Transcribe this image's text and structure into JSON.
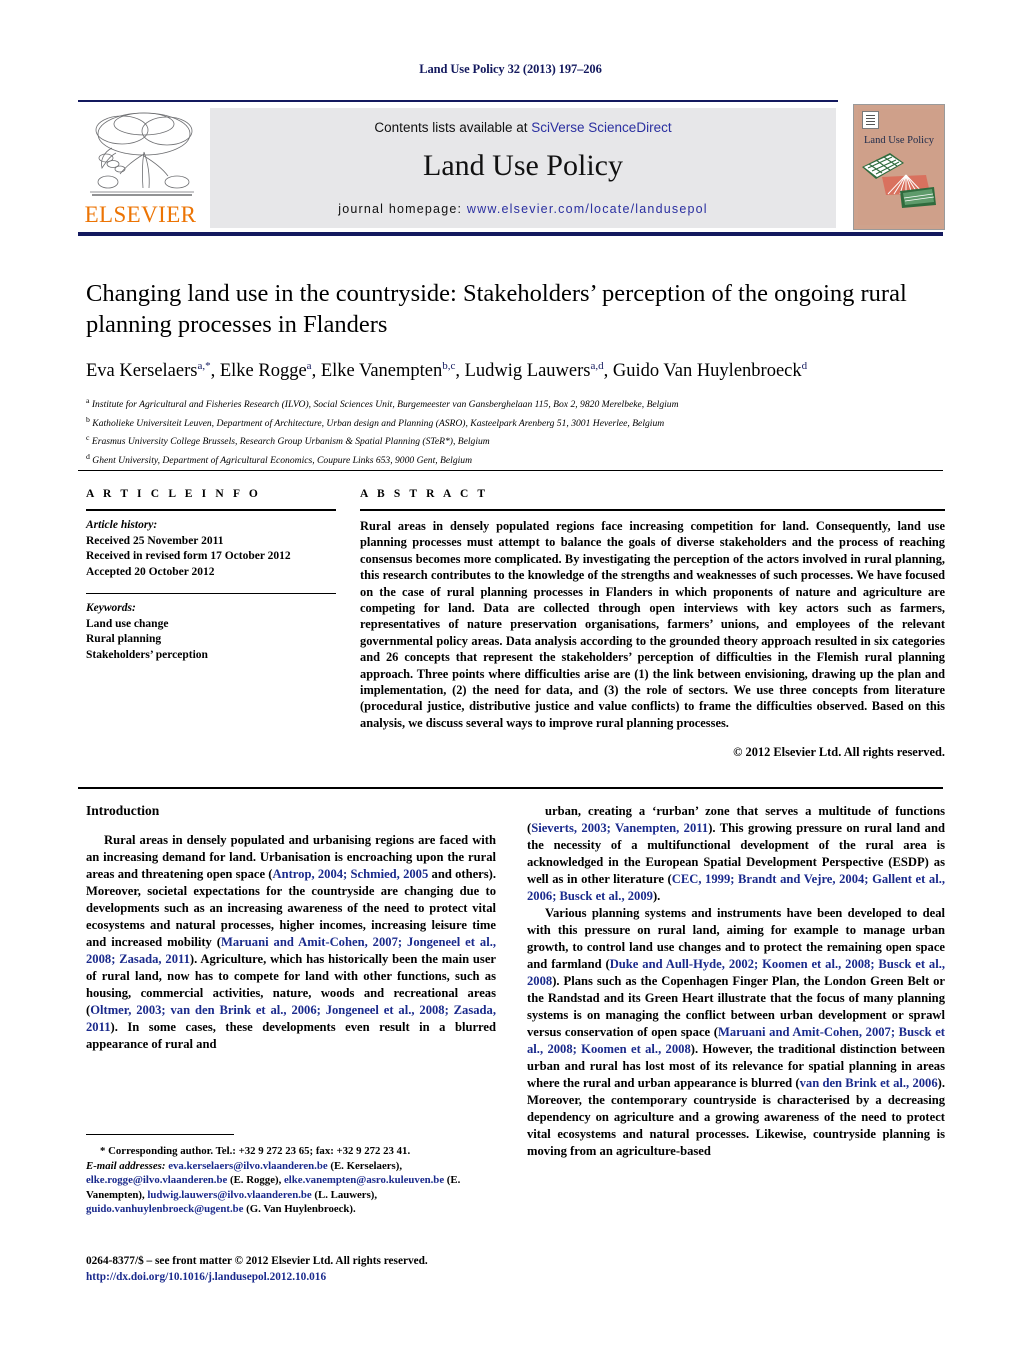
{
  "running_head": "Land Use Policy 32 (2013) 197–206",
  "masthead": {
    "contents_prefix": "Contents lists available at ",
    "contents_link": "SciVerse ScienceDirect",
    "journal_title": "Land Use Policy",
    "homepage_prefix": "journal homepage: ",
    "homepage_url": "www.elsevier.com/locate/landusepol",
    "publisher": "ELSEVIER",
    "cover_title": "Land Use Policy"
  },
  "article": {
    "title": "Changing land use in the countryside: Stakeholders’ perception of the ongoing rural planning processes in Flanders",
    "authors_html": "Eva Kerselaers<sup>a,*</sup>, Elke Rogge<sup>a</sup>, Elke Vanempten<sup>b,c</sup>, Ludwig Lauwers<sup>a,d</sup>, Guido Van Huylenbroeck<sup>d</sup>",
    "affiliations": [
      "Institute for Agricultural and Fisheries Research (ILVO), Social Sciences Unit, Burgemeester van Gansberghelaan 115, Box 2, 9820 Merelbeke, Belgium",
      "Katholieke Universiteit Leuven, Department of Architecture, Urban design and Planning (ASRO), Kasteelpark Arenberg 51, 3001 Heverlee, Belgium",
      "Erasmus University College Brussels, Research Group Urbanism & Spatial Planning (STeR*), Belgium",
      "Ghent University, Department of Agricultural Economics, Coupure Links 653, 9000 Gent, Belgium"
    ],
    "affiliation_markers": [
      "a",
      "b",
      "c",
      "d"
    ]
  },
  "article_info": {
    "heading": "A R T I C L E    I N F O",
    "history_label": "Article history:",
    "history": [
      "Received 25 November 2011",
      "Received in revised form 17 October 2012",
      "Accepted 20 October 2012"
    ],
    "keywords_label": "Keywords:",
    "keywords": [
      "Land use change",
      "Rural planning",
      "Stakeholders’ perception"
    ]
  },
  "abstract": {
    "heading": "A B S T R A C T",
    "text": "Rural areas in densely populated regions face increasing competition for land. Consequently, land use planning processes must attempt to balance the goals of diverse stakeholders and the process of reaching consensus becomes more complicated. By investigating the perception of the actors involved in rural planning, this research contributes to the knowledge of the strengths and weaknesses of such processes. We have focused on the case of rural planning processes in Flanders in which proponents of nature and agriculture are competing for land. Data are collected through open interviews with key actors such as farmers, representatives of nature preservation organisations, farmers’ unions, and employees of the relevant governmental policy areas. Data analysis according to the grounded theory approach resulted in six categories and 26 concepts that represent the stakeholders’ perception of difficulties in the Flemish rural planning approach. Three points where difficulties arise are (1) the link between envisioning, drawing up the plan and implementation, (2) the need for data, and (3) the role of sectors. We use three concepts from literature (procedural justice, distributive justice and value conflicts) to frame the difficulties observed. Based on this analysis, we discuss several ways to improve rural planning processes.",
    "copyright": "© 2012 Elsevier Ltd. All rights reserved."
  },
  "body": {
    "section_heading": "Introduction",
    "left_paragraphs": [
      "Rural areas in densely populated and urbanising regions are faced with an increasing demand for land. Urbanisation is encroaching upon the rural areas and threatening open space (<span class=\"ref\">Antrop, 2004; Schmied, 2005</span> and others). Moreover, societal expectations for the countryside are changing due to developments such as an increasing awareness of the need to protect vital ecosystems and natural processes, higher incomes, increasing leisure time and increased mobility (<span class=\"ref\">Maruani and Amit-Cohen, 2007; Jongeneel et al., 2008; Zasada, 2011</span>). Agriculture, which has historically been the main user of rural land, now has to compete for land with other functions, such as housing, commercial activities, nature, woods and recreational areas (<span class=\"ref\">Oltmer, 2003; van den Brink et al., 2006; Jongeneel et al., 2008; Zasada, 2011</span>). In some cases, these developments even result in a blurred appearance of rural and"
    ],
    "right_paragraphs": [
      "urban, creating a ‘rurban’ zone that serves a multitude of functions (<span class=\"ref\">Sieverts, 2003; Vanempten, 2011</span>). This growing pressure on rural land and the necessity of a multifunctional development of the rural area is acknowledged in the European Spatial Development Perspective (ESDP) as well as in other literature (<span class=\"ref\">CEC, 1999; Brandt and Vejre, 2004; Gallent et al., 2006; Busck et al., 2009</span>).",
      "Various planning systems and instruments have been developed to deal with this pressure on rural land, aiming for example to manage urban growth, to control land use changes and to protect the remaining open space and farmland (<span class=\"ref\">Duke and Aull-Hyde, 2002; Koomen et al., 2008; Busck et al., 2008</span>). Plans such as the Copenhagen Finger Plan, the London Green Belt or the Randstad and its Green Heart illustrate that the focus of many planning systems is on managing the conflict between urban development or sprawl versus conservation of open space (<span class=\"ref\">Maruani and Amit-Cohen, 2007; Busck et al., 2008; Koomen et al., 2008</span>). However, the traditional distinction between urban and rural has lost most of its relevance for spatial planning in areas where the rural and urban appearance is blurred (<span class=\"ref\">van den Brink et al., 2006</span>). Moreover, the contemporary countryside is characterised by a decreasing dependency on agriculture and a growing awareness of the need to protect vital ecosystems and natural processes. Likewise, countryside planning is moving from an agriculture-based"
    ]
  },
  "footnotes": {
    "corresponding": "* Corresponding author. Tel.: +32 9 272 23 65; fax: +32 9 272 23 41.",
    "email_label": "E-mail addresses:",
    "emails_html": "<span class=\"mail\">eva.kerselaers@ilvo.vlaanderen.be</span> (E. Kerselaers), <span class=\"mail\">elke.rogge@ilvo.vlaanderen.be</span> (E. Rogge), <span class=\"mail\">elke.vanempten@asro.kuleuven.be</span> (E. Vanempten), <span class=\"mail\">ludwig.lauwers@ilvo.vlaanderen.be</span> (L. Lauwers), <span class=\"mail\">guido.vanhuylenbroeck@ugent.be</span> (G. Van Huylenbroeck).",
    "frontmatter": "0264-8377/$ – see front matter © 2012 Elsevier Ltd. All rights reserved.",
    "doi": "http://dx.doi.org/10.1016/j.landusepol.2012.10.016"
  },
  "colors": {
    "link": "#2a2fa0",
    "reference": "#1a2a8c",
    "running_head": "#13195e",
    "elsevier_orange": "#ec7404",
    "band_gray": "#e7e7e9"
  }
}
